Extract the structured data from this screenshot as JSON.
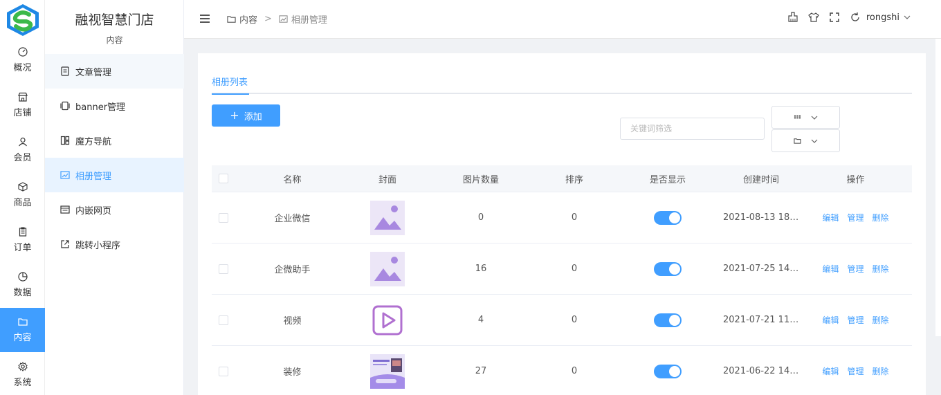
{
  "app": {
    "brand": "融视智慧门店",
    "section_title": "内容"
  },
  "rail": [
    {
      "label": "概况",
      "icon": "gauge-icon"
    },
    {
      "label": "店铺",
      "icon": "store-icon"
    },
    {
      "label": "会员",
      "icon": "user-icon"
    },
    {
      "label": "商品",
      "icon": "box-icon"
    },
    {
      "label": "订单",
      "icon": "clipboard-icon"
    },
    {
      "label": "数据",
      "icon": "pie-icon"
    },
    {
      "label": "内容",
      "icon": "folder-icon",
      "active": true
    },
    {
      "label": "系统",
      "icon": "gear-icon"
    }
  ],
  "submenu": [
    {
      "label": "文章管理",
      "icon": "article-icon"
    },
    {
      "label": "banner管理",
      "icon": "banner-icon"
    },
    {
      "label": "魔方导航",
      "icon": "grid-nav-icon"
    },
    {
      "label": "相册管理",
      "icon": "album-icon",
      "active": true
    },
    {
      "label": "内嵌网页",
      "icon": "webpage-icon"
    },
    {
      "label": "跳转小程序",
      "icon": "external-link-icon"
    }
  ],
  "header": {
    "breadcrumb": [
      "内容",
      "相册管理"
    ],
    "username": "rongshi"
  },
  "page": {
    "tab": "相册列表",
    "add_label": "添加",
    "search_placeholder": "关键词筛选"
  },
  "table": {
    "columns": [
      "名称",
      "封面",
      "图片数量",
      "排序",
      "是否显示",
      "创建时间",
      "操作"
    ],
    "rows": [
      {
        "name": "企业微信",
        "cover": "image-placeholder",
        "count": "0",
        "sort": "0",
        "show": true,
        "created": "2021-08-13 18:..."
      },
      {
        "name": "企微助手",
        "cover": "image-placeholder",
        "count": "16",
        "sort": "0",
        "show": true,
        "created": "2021-07-25 14:..."
      },
      {
        "name": "视频",
        "cover": "video-play",
        "count": "4",
        "sort": "0",
        "show": true,
        "created": "2021-07-21 11:..."
      },
      {
        "name": "装修",
        "cover": "photo",
        "count": "27",
        "sort": "0",
        "show": true,
        "created": "2021-06-22 14:..."
      }
    ],
    "ops": {
      "edit": "编辑",
      "manage": "管理",
      "delete": "删除"
    }
  },
  "colors": {
    "primary": "#409eff",
    "active_menu_bg": "#e8f3ff",
    "logo_green": "#3cb94a",
    "logo_blue": "#1e88e5",
    "thumb_purple": "#a888e0"
  }
}
